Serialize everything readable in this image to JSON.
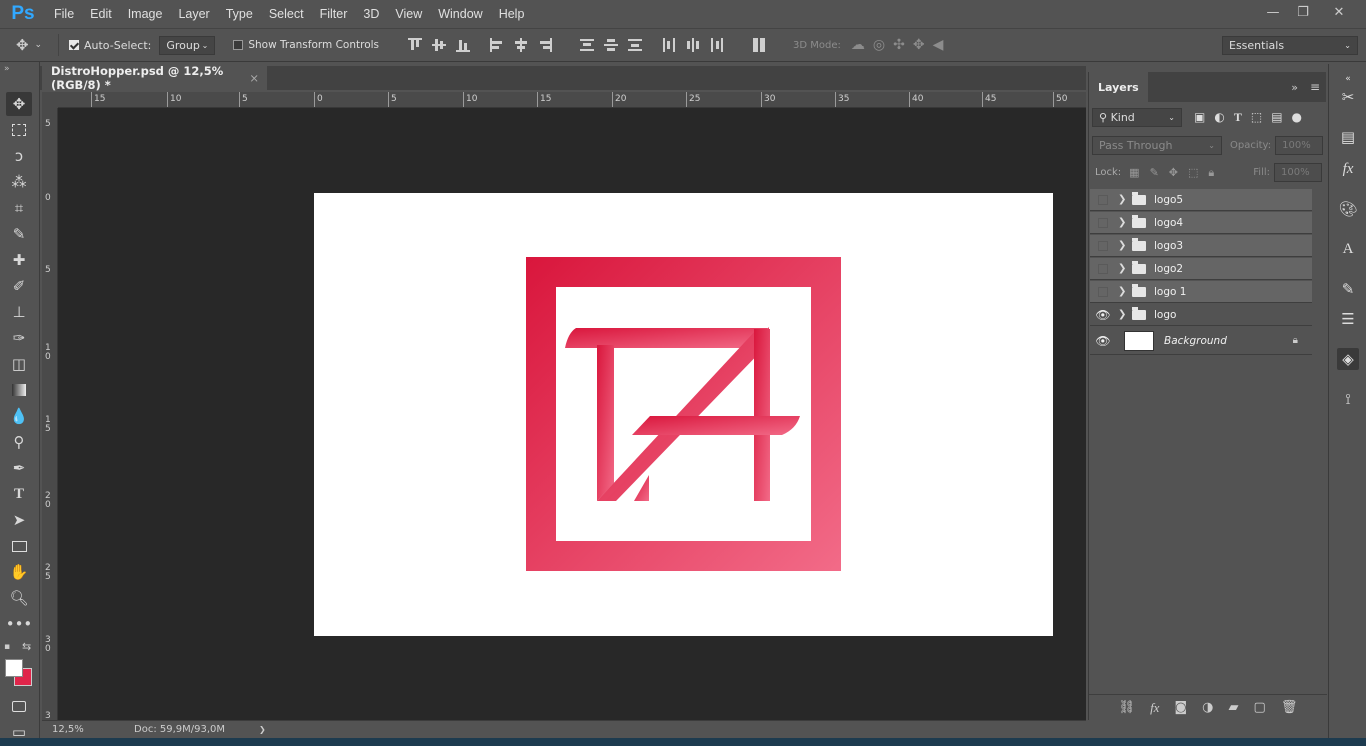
{
  "app": {
    "logo_text": "Ps"
  },
  "menu": [
    "File",
    "Edit",
    "Image",
    "Layer",
    "Type",
    "Select",
    "Filter",
    "3D",
    "View",
    "Window",
    "Help"
  ],
  "window_controls": {
    "minimize": "—",
    "restore": "❐",
    "close": "✕"
  },
  "options": {
    "auto_select_label": "Auto-Select:",
    "auto_select_checked": true,
    "auto_select_value": "Group",
    "transform_controls_label": "Show Transform Controls",
    "mode_3d_label": "3D Mode:",
    "workspace": "Essentials"
  },
  "document": {
    "tab_title": "DistroHopper.psd @ 12,5% (RGB/8) *",
    "close_glyph": "×"
  },
  "rulers": {
    "h_ticks": [
      "15",
      "10",
      "5",
      "0",
      "5",
      "10",
      "15",
      "20",
      "25",
      "30",
      "35",
      "40",
      "45",
      "50"
    ],
    "v_ticks": [
      "5",
      "0",
      "5",
      "1\n0",
      "1\n5",
      "2\n0",
      "2\n5",
      "3\n0",
      "3"
    ]
  },
  "status": {
    "zoom": "12,5%",
    "doc_info": "Doc: 59,9M/93,0M",
    "arrow": "❯"
  },
  "layers_panel": {
    "tab": "Layers",
    "filter_kind": "Kind",
    "blend_mode": "Pass Through",
    "opacity_label": "Opacity:",
    "opacity_value": "100%",
    "lock_label": "Lock:",
    "fill_label": "Fill:",
    "fill_value": "100%",
    "layers": [
      {
        "name": "logo5",
        "visible": false,
        "type": "group"
      },
      {
        "name": "logo4",
        "visible": false,
        "type": "group"
      },
      {
        "name": "logo3",
        "visible": false,
        "type": "group"
      },
      {
        "name": "logo2",
        "visible": false,
        "type": "group"
      },
      {
        "name": "logo 1",
        "visible": false,
        "type": "group"
      },
      {
        "name": "logo",
        "visible": true,
        "type": "group"
      },
      {
        "name": "Background",
        "visible": true,
        "type": "background",
        "locked": true
      }
    ]
  },
  "colors": {
    "accent": "#31a8ff",
    "logo_gradient_start": "#d9163c",
    "logo_gradient_end": "#f26b88",
    "foreground_swatch": "#ffffff",
    "background_swatch": "#e0254a"
  }
}
